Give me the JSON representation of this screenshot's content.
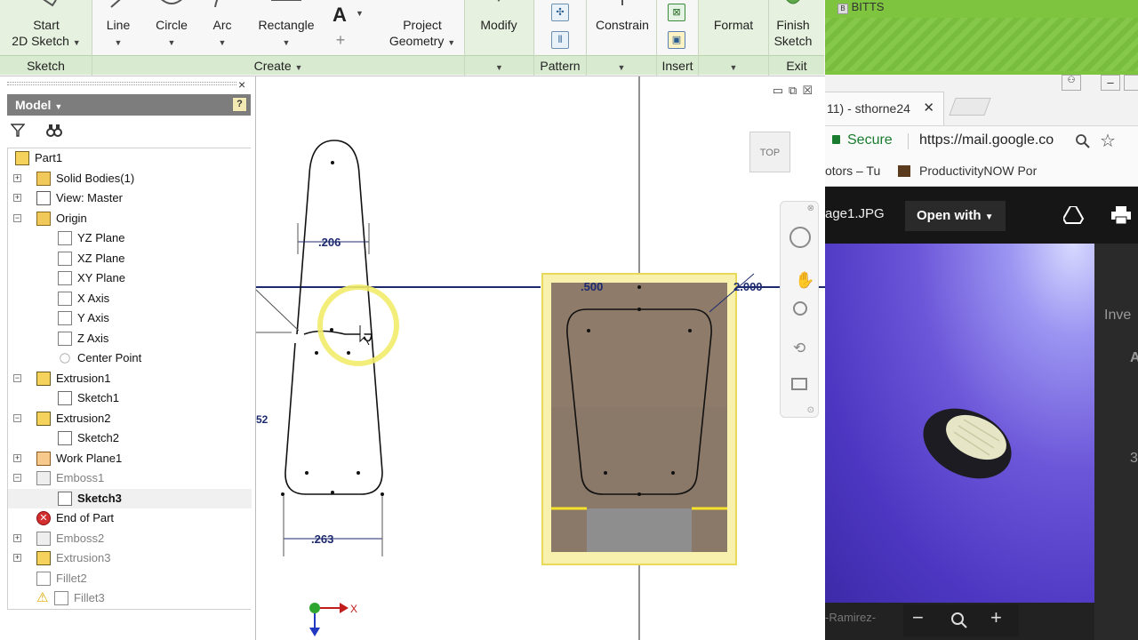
{
  "ribbon": {
    "start_sketch": {
      "line1": "Start",
      "line2": "2D Sketch"
    },
    "line": "Line",
    "circle": "Circle",
    "arc": "Arc",
    "rectangle": "Rectangle",
    "text_glyph": "A",
    "project_geometry": {
      "line1": "Project",
      "line2": "Geometry"
    },
    "modify": "Modify",
    "constrain": "Constrain",
    "format": "Format",
    "finish_sketch": {
      "line1": "Finish",
      "line2": "Sketch"
    },
    "panels": {
      "sketch": "Sketch",
      "create": "Create",
      "pattern": "Pattern",
      "insert": "Insert",
      "exit": "Exit"
    }
  },
  "browser": {
    "title": "Model",
    "help_glyph": "?",
    "close_glyph": "×",
    "items": [
      {
        "label": "Part1",
        "level": 0,
        "exp": "",
        "icon": "part-icon"
      },
      {
        "label": "Solid Bodies(1)",
        "level": 1,
        "exp": "+",
        "icon": "folder-icon"
      },
      {
        "label": "View: Master",
        "level": 1,
        "exp": "+",
        "icon": "view-icon"
      },
      {
        "label": "Origin",
        "level": 1,
        "exp": "−",
        "icon": "folder-icon"
      },
      {
        "label": "YZ Plane",
        "level": 2,
        "exp": "",
        "icon": "plane-icon"
      },
      {
        "label": "XZ Plane",
        "level": 2,
        "exp": "",
        "icon": "plane-icon"
      },
      {
        "label": "XY Plane",
        "level": 2,
        "exp": "",
        "icon": "plane-icon"
      },
      {
        "label": "X Axis",
        "level": 2,
        "exp": "",
        "icon": "axis-icon"
      },
      {
        "label": "Y Axis",
        "level": 2,
        "exp": "",
        "icon": "axis-icon"
      },
      {
        "label": "Z Axis",
        "level": 2,
        "exp": "",
        "icon": "axis-icon"
      },
      {
        "label": "Center Point",
        "level": 2,
        "exp": "",
        "icon": "point-icon"
      },
      {
        "label": "Extrusion1",
        "level": 1,
        "exp": "−",
        "icon": "extrusion-icon"
      },
      {
        "label": "Sketch1",
        "level": 2,
        "exp": "",
        "icon": "sketch-icon"
      },
      {
        "label": "Extrusion2",
        "level": 1,
        "exp": "−",
        "icon": "extrusion-icon"
      },
      {
        "label": "Sketch2",
        "level": 2,
        "exp": "",
        "icon": "sketch-icon"
      },
      {
        "label": "Work Plane1",
        "level": 1,
        "exp": "+",
        "icon": "workplane-icon"
      },
      {
        "label": "Emboss1",
        "level": 1,
        "exp": "−",
        "icon": "emboss-icon",
        "dim": true
      },
      {
        "label": "Sketch3",
        "level": 2,
        "exp": "",
        "icon": "sketch-icon",
        "bold": true,
        "selected": true
      },
      {
        "label": "End of Part",
        "level": 1,
        "exp": "",
        "icon": "end-of-part-icon"
      },
      {
        "label": "Emboss2",
        "level": 1,
        "exp": "+",
        "icon": "emboss-icon",
        "dim": true
      },
      {
        "label": "Extrusion3",
        "level": 1,
        "exp": "+",
        "icon": "extrusion-icon",
        "dim": true
      },
      {
        "label": "Fillet2",
        "level": 1,
        "exp": "",
        "icon": "fillet-icon",
        "dim": true
      },
      {
        "label": "Fillet3",
        "level": 1,
        "exp": "",
        "icon": "fillet-warning-icon",
        "dim": true
      }
    ]
  },
  "graphics": {
    "viewcube_label": "TOP",
    "dimensions": {
      "top_width": ".206",
      "bottom_width": ".263",
      "left_partial": "52",
      "right_width": ".500",
      "right_length": "2.000"
    },
    "triad_x": "X"
  },
  "chrome": {
    "banner_text": "BITTS",
    "tab_title": "11) - sthorne24",
    "secure_label": "Secure",
    "url": "https://mail.google.co",
    "bookmark_1": "otors – Tu",
    "bookmark_2": "ProductivityNOW Por",
    "viewer": {
      "file_name": "age1.JPG",
      "open_with": "Open with",
      "side_text_1": "Inve",
      "side_text_2": "A",
      "side_text_3": "3",
      "bottom_left_text": "-Ramirez-"
    }
  }
}
